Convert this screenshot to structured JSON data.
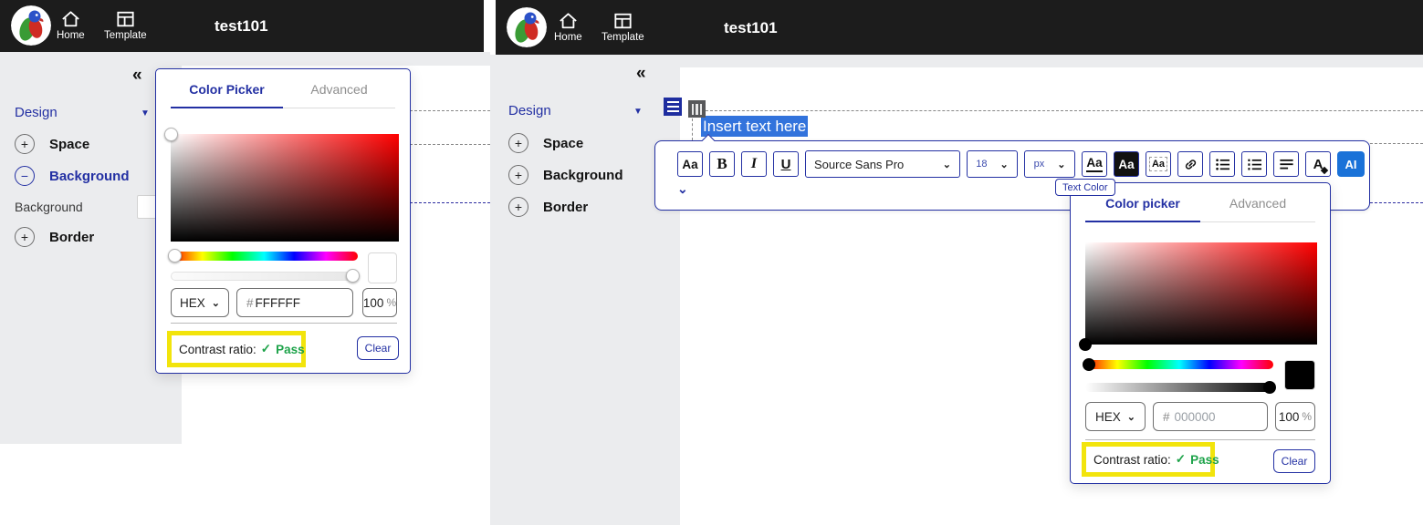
{
  "colors": {
    "accent": "#2330a3",
    "topbar_bg": "#1c1c1c",
    "sidebar_bg": "#ebecee",
    "selection_blue": "#3273dc",
    "ai_blue": "#1a72d8",
    "highlight_yellow": "#f2e40c",
    "pass_green": "#1ea34a",
    "block_navy": "#1e2d9f",
    "handle_gray": "#57585a"
  },
  "topbar": {
    "title": "test101",
    "home_label": "Home",
    "template_label": "Template"
  },
  "sidebar": {
    "collapse_glyph": "«",
    "design_label": "Design",
    "space_label": "Space",
    "background_label": "Background",
    "border_label": "Border",
    "background_property_label": "Background"
  },
  "glyphs": {
    "plus": "+",
    "minus": "−",
    "caret_down": "▼",
    "chevron_down": "⌄",
    "check": "✓"
  },
  "canvas": {
    "text_selection": "Insert text here"
  },
  "toolbar": {
    "style_label": "Aa",
    "bold_label": "B",
    "italic_label": "I",
    "underline_label": "U",
    "font_family_value": "Source Sans Pro",
    "font_size_value": "18",
    "unit_value": "px",
    "text_color_label": "Aa",
    "fill_color_label": "Aa",
    "format_label": "Aa",
    "ai_label": "AI",
    "tooltip_text": "Text Color"
  },
  "picker_left": {
    "tab_active": "Color Picker",
    "tab_inactive": "Advanced",
    "format_value": "HEX",
    "hex_prefix": "#",
    "hex_value": "FFFFFF",
    "opacity_value": "100",
    "opacity_unit": "%",
    "contrast_label": "Contrast ratio:",
    "contrast_status": "Pass",
    "clear_label": "Clear",
    "selected_color": "#FFFFFF"
  },
  "picker_right": {
    "tab_active": "Color picker",
    "tab_inactive": "Advanced",
    "format_value": "HEX",
    "hex_prefix": "#",
    "hex_value": "000000",
    "opacity_value": "100",
    "opacity_unit": "%",
    "contrast_label": "Contrast ratio:",
    "contrast_status": "Pass",
    "clear_label": "Clear",
    "selected_color": "#000000"
  }
}
